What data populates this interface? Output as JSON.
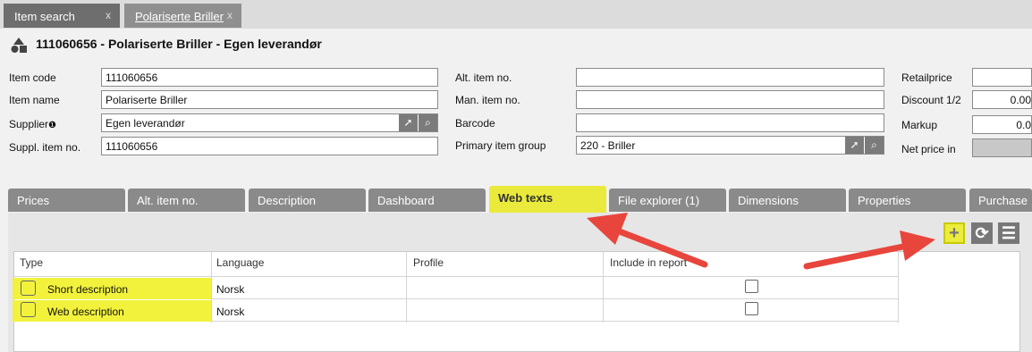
{
  "doc_tabs": [
    {
      "label": "Item search",
      "close": "x"
    },
    {
      "label": "Polariserte Briller",
      "close": "x"
    }
  ],
  "title": "111060656 - Polariserte Briller - Egen leverandør",
  "form": {
    "item_code": {
      "label": "Item code",
      "value": "111060656"
    },
    "item_name": {
      "label": "Item name",
      "value": "Polariserte Briller"
    },
    "supplier": {
      "label": "Supplier",
      "value": "Egen leverandør"
    },
    "suppl_item_no": {
      "label": "Suppl. item no.",
      "value": "111060656"
    },
    "alt_item_no": {
      "label": "Alt. item no.",
      "value": ""
    },
    "man_item_no": {
      "label": "Man. item no.",
      "value": ""
    },
    "barcode": {
      "label": "Barcode",
      "value": ""
    },
    "primary_item_group": {
      "label": "Primary item group",
      "value": "220 - Briller"
    },
    "retailprice": {
      "label": "Retailprice",
      "value": ""
    },
    "discount": {
      "label": "Discount 1/2",
      "value": "0.00"
    },
    "markup": {
      "label": "Markup",
      "value": "0.0"
    },
    "net_price_in": {
      "label": "Net price in",
      "value": ""
    }
  },
  "tabs": [
    "Prices",
    "Alt. item no.",
    "Description",
    "Dashboard",
    "Web texts",
    "File explorer (1)",
    "Dimensions",
    "Properties",
    "Purchase"
  ],
  "active_tab": "Web texts",
  "toolbar": {
    "add": "+",
    "refresh": "⟳",
    "menu": "☰"
  },
  "table": {
    "columns": [
      "Type",
      "Language",
      "Profile",
      "Include in report"
    ],
    "rows": [
      {
        "type": "Short description",
        "language": "Norsk",
        "profile": "",
        "include": false
      },
      {
        "type": "Web description",
        "language": "Norsk",
        "profile": "",
        "include": false
      }
    ]
  },
  "colors": {
    "highlight": "#f2f23c",
    "arrow": "#e8453c",
    "tab": "#8a8a8a"
  }
}
